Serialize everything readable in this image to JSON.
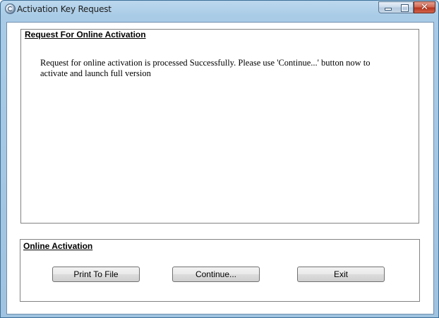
{
  "window": {
    "title": "Activation Key Request",
    "controls": {
      "minimize_icon": "minimize-icon",
      "maximize_icon": "maximize-icon",
      "close_icon": "close-icon",
      "close_glyph": "✕"
    }
  },
  "request_group": {
    "title": "Request For Online Activation",
    "message": "Request for online activation is processed Successfully. Please use 'Continue...' button now to activate and launch full version"
  },
  "activation_group": {
    "title": "Online Activation",
    "buttons": {
      "print": "Print To File",
      "continue": "Continue...",
      "exit": "Exit"
    }
  },
  "colors": {
    "titlebar": "#a9cbe6",
    "close_button": "#c2432b",
    "group_border": "#828282"
  }
}
